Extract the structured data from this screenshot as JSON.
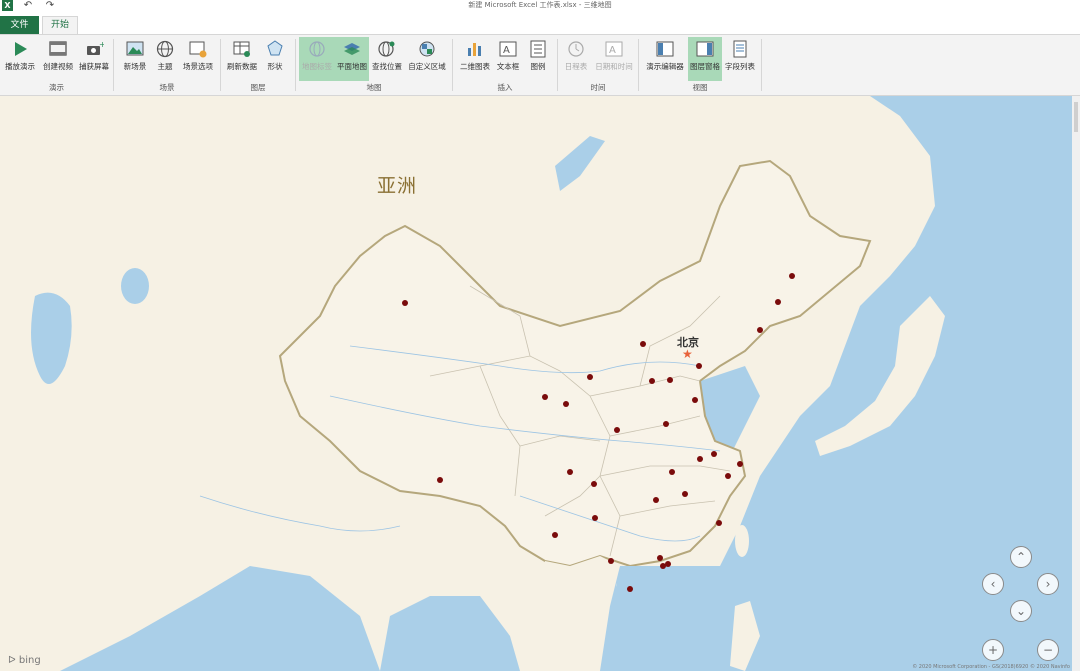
{
  "window": {
    "title": "新建 Microsoft Excel 工作表.xlsx - 三维地图",
    "app_icon": "X"
  },
  "tabs": {
    "file": "文件",
    "home": "开始"
  },
  "ribbon": {
    "groups": [
      {
        "label": "演示",
        "buttons": [
          {
            "label": "播放演示",
            "icon": "play-icon"
          },
          {
            "label": "创建视频",
            "icon": "video-icon"
          },
          {
            "label": "捕获屏幕",
            "icon": "camera-icon"
          }
        ]
      },
      {
        "label": "场景",
        "buttons": [
          {
            "label": "新场景",
            "icon": "new-scene-icon"
          },
          {
            "label": "主题",
            "icon": "globe-theme-icon"
          },
          {
            "label": "场景选项",
            "icon": "scene-options-icon"
          }
        ]
      },
      {
        "label": "图层",
        "buttons": [
          {
            "label": "刷新数据",
            "icon": "refresh-icon"
          },
          {
            "label": "形状",
            "icon": "shape-icon"
          }
        ]
      },
      {
        "label": "地图",
        "buttons": [
          {
            "label": "地图标签",
            "icon": "map-labels-icon"
          },
          {
            "label": "平面地图",
            "icon": "flat-map-icon"
          },
          {
            "label": "查找位置",
            "icon": "find-location-icon"
          },
          {
            "label": "自定义区域",
            "icon": "custom-region-icon"
          }
        ]
      },
      {
        "label": "插入",
        "buttons": [
          {
            "label": "二维图表",
            "icon": "chart-icon"
          },
          {
            "label": "文本框",
            "icon": "textbox-icon"
          },
          {
            "label": "图例",
            "icon": "legend-icon"
          }
        ]
      },
      {
        "label": "时间",
        "buttons": [
          {
            "label": "日程表",
            "icon": "clock-icon"
          },
          {
            "label": "日期和时间",
            "icon": "datetime-icon"
          }
        ]
      },
      {
        "label": "视图",
        "buttons": [
          {
            "label": "演示编辑器",
            "icon": "tour-editor-icon"
          },
          {
            "label": "图层窗格",
            "icon": "layer-pane-icon"
          },
          {
            "label": "字段列表",
            "icon": "field-list-icon"
          }
        ]
      }
    ]
  },
  "map": {
    "continent_label": "亚洲",
    "capital_label": "北京",
    "point_color": "#7a0b0b",
    "capital_color": "#e8623a",
    "land_color": "#f6f1e4",
    "water_color": "#aacfe8",
    "attribution": "© 2020 Microsoft Corporation - GS(2018)6920 © 2020 Navinfo",
    "logo": "bing"
  }
}
